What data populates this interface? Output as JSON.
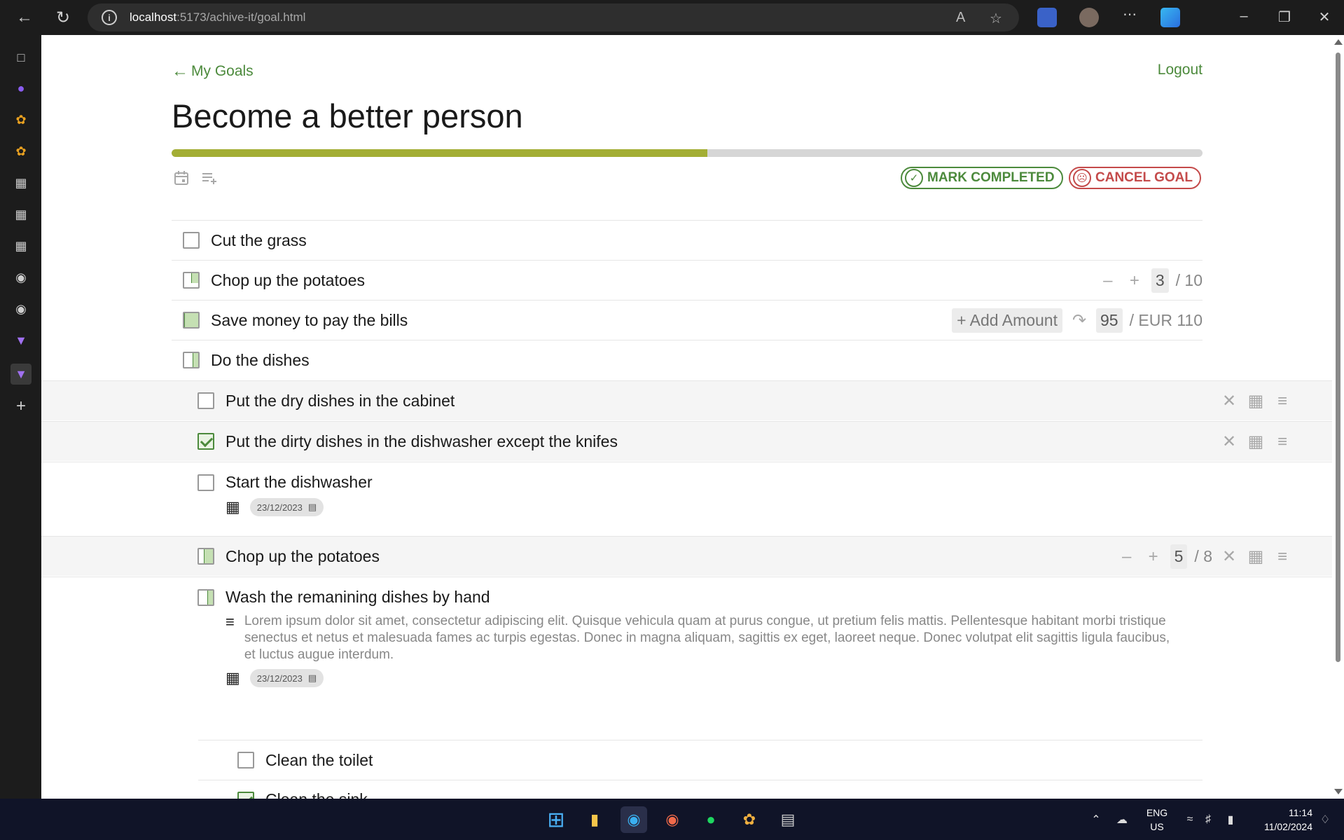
{
  "browser": {
    "url_host": "localhost",
    "url_rest": ":5173/achive-it/goal.html"
  },
  "nav": {
    "back_label": "My Goals",
    "logout_label": "Logout"
  },
  "goal": {
    "title": "Become a better person",
    "progress": 0.52,
    "mark_completed_label": "MARK COMPLETED",
    "cancel_goal_label": "CANCEL GOAL"
  },
  "tasks": [
    {
      "label": "Cut the grass"
    },
    {
      "label": "Chop up the potatoes",
      "current": "3",
      "total": "/ 10"
    },
    {
      "label": "Save money to pay the bills",
      "add_label": "+ Add Amount",
      "current": "95",
      "total": "/ EUR 110"
    },
    {
      "label": "Do the dishes"
    }
  ],
  "subtasks": [
    {
      "label": "Put the dry dishes in the cabinet"
    },
    {
      "label": "Put the dirty dishes in the dishwasher except the knifes"
    },
    {
      "label": "Start the dishwasher",
      "date": "23/12/2023"
    },
    {
      "label": "Chop up the potatoes",
      "current": "5",
      "total": "/ 8"
    },
    {
      "label": "Wash the remanining dishes by hand",
      "description": "Lorem ipsum dolor sit amet, consectetur adipiscing elit. Quisque vehicula quam at purus congue, ut pretium felis mattis. Pellentesque habitant morbi tristique senectus et netus et malesuada fames ac turpis egestas. Donec in magna aliquam, sagittis ex eget, laoreet neque. Donec volutpat elit sagittis ligula faucibus, et luctus augue interdum.",
      "date": "23/12/2023"
    }
  ],
  "subsubtasks": [
    {
      "label": "Clean the toilet"
    },
    {
      "label": "Clean the sink"
    }
  ],
  "taskbar": {
    "lang_top": "ENG",
    "lang_bottom": "US",
    "time": "11:14",
    "date": "11/02/2024"
  },
  "colors": {
    "accent": "#4c8a3c",
    "progress": "#a3ae35",
    "danger": "#c44a4a"
  }
}
